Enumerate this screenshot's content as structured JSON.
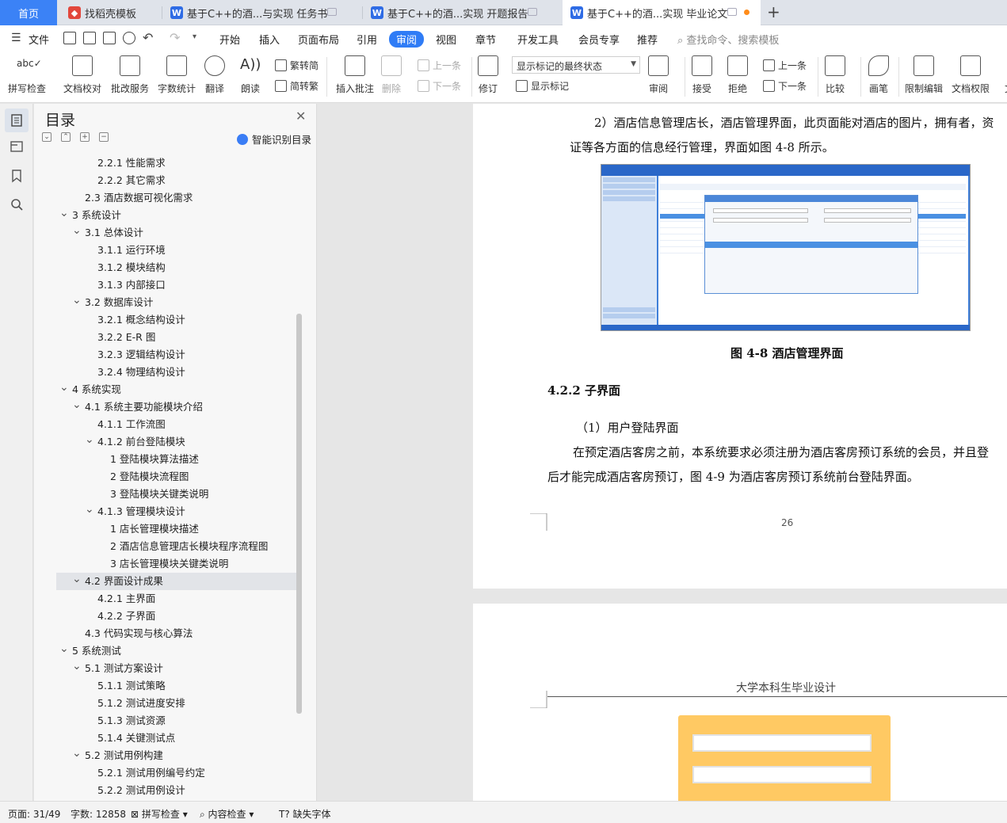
{
  "tabs": {
    "home": "首页",
    "items": [
      {
        "label": "找稻壳模板"
      },
      {
        "label": "基于C++的酒...与实现 任务书"
      },
      {
        "label": "基于C++的酒...实现 开题报告"
      },
      {
        "label": "基于C++的酒...实现 毕业论文"
      }
    ],
    "new_tab": "+"
  },
  "menu": {
    "file": "文件",
    "items": [
      "开始",
      "插入",
      "页面布局",
      "引用",
      "审阅",
      "视图",
      "章节",
      "开发工具",
      "会员专享",
      "推荐"
    ],
    "active": "审阅",
    "search_placeholder": "查找命令、搜索模板"
  },
  "ribbon": {
    "spell_check": "拼写检查",
    "doc_proof": "文档校对",
    "batch_service": "批改服务",
    "word_count": "字数统计",
    "translate": "翻译",
    "read_aloud": "朗读",
    "to_traditional": "繁转简",
    "to_simplified": "简转繁",
    "insert_comment": "插入批注",
    "delete": "删除",
    "prev_comment": "上一条",
    "next_comment": "下一条",
    "track_changes": "修订",
    "markup_state": "显示标记的最终状态",
    "show_markup": "显示标记",
    "review": "审阅",
    "accept": "接受",
    "reject": "拒绝",
    "prev_change": "上一条",
    "next_change": "下一条",
    "compare": "比较",
    "pen": "画笔",
    "restrict_edit": "限制编辑",
    "doc_permission": "文档权限",
    "overflow": "文"
  },
  "toc": {
    "title": "目录",
    "smart_label": "智能识别目录",
    "items": [
      {
        "text": "2.2.1  性能需求",
        "level": 3,
        "chev": ""
      },
      {
        "text": "2.2.2  其它需求",
        "level": 3,
        "chev": ""
      },
      {
        "text": "2.3  酒店数据可视化需求",
        "level": 2,
        "chev": ""
      },
      {
        "text": "3  系统设计",
        "level": 1,
        "chev": "v"
      },
      {
        "text": "3.1  总体设计",
        "level": 2,
        "chev": "v"
      },
      {
        "text": "3.1.1 运行环境",
        "level": 3,
        "chev": ""
      },
      {
        "text": "3.1.2 模块结构",
        "level": 3,
        "chev": ""
      },
      {
        "text": "3.1.3 内部接口",
        "level": 3,
        "chev": ""
      },
      {
        "text": "3.2  数据库设计",
        "level": 2,
        "chev": "v"
      },
      {
        "text": "3.2.1  概念结构设计",
        "level": 3,
        "chev": ""
      },
      {
        "text": "3.2.2 E-R 图",
        "level": 3,
        "chev": ""
      },
      {
        "text": "3.2.3  逻辑结构设计",
        "level": 3,
        "chev": ""
      },
      {
        "text": "3.2.4  物理结构设计",
        "level": 3,
        "chev": ""
      },
      {
        "text": "4  系统实现",
        "level": 1,
        "chev": "v"
      },
      {
        "text": "4.1  系统主要功能模块介绍",
        "level": 2,
        "chev": "v"
      },
      {
        "text": "4.1.1  工作流图",
        "level": 3,
        "chev": ""
      },
      {
        "text": "4.1.2  前台登陆模块",
        "level": 3,
        "chev": "v"
      },
      {
        "text": "1 登陆模块算法描述",
        "level": 4,
        "chev": ""
      },
      {
        "text": "2  登陆模块流程图",
        "level": 4,
        "chev": ""
      },
      {
        "text": "3 登陆模块关键类说明",
        "level": 4,
        "chev": ""
      },
      {
        "text": "4.1.3 管理模块设计",
        "level": 3,
        "chev": "v"
      },
      {
        "text": "1 店长管理模块描述",
        "level": 4,
        "chev": ""
      },
      {
        "text": "2 酒店信息管理店长模块程序流程图",
        "level": 4,
        "chev": ""
      },
      {
        "text": "3 店长管理模块关键类说明",
        "level": 4,
        "chev": ""
      },
      {
        "text": "4.2  界面设计成果",
        "level": 2,
        "chev": "v",
        "selected": true
      },
      {
        "text": "4.2.1  主界面",
        "level": 3,
        "chev": ""
      },
      {
        "text": "4.2.2  子界面",
        "level": 3,
        "chev": ""
      },
      {
        "text": "4.3  代码实现与核心算法",
        "level": 2,
        "chev": ""
      },
      {
        "text": "5  系统测试",
        "level": 1,
        "chev": "v"
      },
      {
        "text": "5.1  测试方案设计",
        "level": 2,
        "chev": "v"
      },
      {
        "text": "5.1.1  测试策略",
        "level": 3,
        "chev": ""
      },
      {
        "text": "5.1.2  测试进度安排",
        "level": 3,
        "chev": ""
      },
      {
        "text": "5.1.3  测试资源",
        "level": 3,
        "chev": ""
      },
      {
        "text": "5.1.4  关键测试点",
        "level": 3,
        "chev": ""
      },
      {
        "text": "5.2  测试用例构建",
        "level": 2,
        "chev": "v"
      },
      {
        "text": "5.2.1  测试用例编号约定",
        "level": 3,
        "chev": ""
      },
      {
        "text": "5.2.2  测试用例设计",
        "level": 3,
        "chev": ""
      }
    ]
  },
  "document": {
    "para1_line1": "2）酒店信息管理店长，酒店管理界面，此页面能对酒店的图片，拥有者，资",
    "para1_line2": "证等各方面的信息经行管理，界面如图 4-8 所示。",
    "figure_caption": "图 4-8  酒店管理界面",
    "section_heading": "4.2.2  子界面",
    "sub_heading": "（1）用户登陆界面",
    "para2_line1": "在预定酒店客房之前，本系统要求必须注册为酒店客房预订系统的会员，并且登",
    "para2_line2": "后才能完成酒店客房预订，图 4-9 为酒店客房预订系统前台登陆界面。",
    "page_number": "26",
    "page2_header": "大学本科生毕业设计"
  },
  "status": {
    "page": "页面: 31/49",
    "words": "字数: 12858",
    "spell": "拼写检查",
    "content_check": "内容检查",
    "missing_font": "缺失字体"
  },
  "colors": {
    "accent": "#2f7cf6",
    "home_tab": "#3b82f6",
    "login_panel": "#ffc963"
  }
}
